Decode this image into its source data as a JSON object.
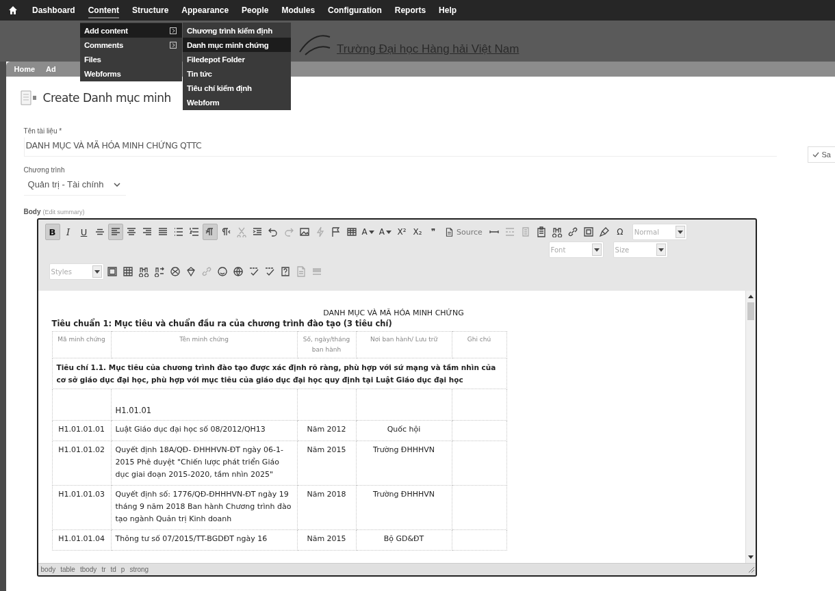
{
  "admin_menu": [
    {
      "label": "Dashboard",
      "selected": false
    },
    {
      "label": "Content",
      "selected": true
    },
    {
      "label": "Structure",
      "selected": false
    },
    {
      "label": "Appearance",
      "selected": false
    },
    {
      "label": "People",
      "selected": false
    },
    {
      "label": "Modules",
      "selected": false
    },
    {
      "label": "Configuration",
      "selected": false
    },
    {
      "label": "Reports",
      "selected": false
    },
    {
      "label": "Help",
      "selected": false
    }
  ],
  "content_menu": [
    {
      "label": "Add content",
      "selected": true,
      "has_submenu": true
    },
    {
      "label": "Comments",
      "selected": false,
      "has_submenu": true
    },
    {
      "label": "Files",
      "selected": false,
      "has_submenu": false
    },
    {
      "label": "Webforms",
      "selected": false,
      "has_submenu": false
    }
  ],
  "add_content_menu": [
    {
      "label": "Chương trình kiểm định",
      "selected": false
    },
    {
      "label": "Danh mục minh chứng",
      "selected": true
    },
    {
      "label": "Filedepot Folder",
      "selected": false
    },
    {
      "label": "Tin tức",
      "selected": false
    },
    {
      "label": "Tiêu chí kiểm định",
      "selected": false
    },
    {
      "label": "Webform",
      "selected": false
    }
  ],
  "header": {
    "site_name": "Trường Đại học Hàng hải Việt Nam"
  },
  "breadcrumb": [
    "Home",
    "Ad"
  ],
  "page_title": "Create Danh mục minh",
  "save_button": "Sa",
  "title_field": {
    "label": "Tên tài liệu *",
    "value": "DANH MỤC VÀ MÃ HÓA MINH CHỨNG QTTC"
  },
  "program_field": {
    "label": "Chương trình",
    "value": "Quản trị - Tài chính"
  },
  "body_field": {
    "label": "Body",
    "link": "(Edit summary)"
  },
  "editor": {
    "toolbar_row_1": [
      {
        "kind": "glyph",
        "label": "B",
        "active": true,
        "disabled": false
      },
      {
        "kind": "glyph",
        "label": "I",
        "active": false,
        "disabled": false
      },
      {
        "kind": "glyph",
        "label": "U",
        "active": false,
        "disabled": false
      },
      {
        "kind": "strikethrough",
        "active": false,
        "disabled": false
      },
      {
        "kind": "align-left",
        "active": true,
        "disabled": false
      },
      {
        "kind": "align-center",
        "active": false,
        "disabled": false
      },
      {
        "kind": "align-right",
        "active": false,
        "disabled": false
      },
      {
        "kind": "align-justify",
        "active": false,
        "disabled": false
      },
      {
        "kind": "bullet-list",
        "active": false,
        "disabled": false
      },
      {
        "kind": "numbered-list",
        "active": false,
        "disabled": false
      },
      {
        "kind": "paragraph-ltr",
        "active": true,
        "disabled": false
      },
      {
        "kind": "paragraph-rtl",
        "active": false,
        "disabled": false
      },
      {
        "kind": "scissors",
        "active": false,
        "disabled": true
      },
      {
        "kind": "indent",
        "active": false,
        "disabled": false
      },
      {
        "kind": "undo",
        "active": false,
        "disabled": false
      },
      {
        "kind": "redo",
        "active": false,
        "disabled": true
      },
      {
        "kind": "image",
        "active": false,
        "disabled": false
      },
      {
        "kind": "lightning",
        "active": false,
        "disabled": true
      },
      {
        "kind": "flag",
        "active": false,
        "disabled": false
      },
      {
        "kind": "table",
        "active": false,
        "disabled": false
      },
      {
        "kind": "color-glyph",
        "label": "A",
        "active": false,
        "disabled": false
      },
      {
        "kind": "color-glyph",
        "label": "A",
        "active": false,
        "disabled": false
      },
      {
        "kind": "glyph",
        "label": "X²",
        "active": false,
        "disabled": false
      },
      {
        "kind": "glyph",
        "label": "X₂",
        "active": false,
        "disabled": false
      },
      {
        "kind": "glyph",
        "label": "❞",
        "active": false,
        "disabled": false
      },
      {
        "kind": "source",
        "label": "Source",
        "active": false,
        "disabled": false
      },
      {
        "kind": "horizontal-rule",
        "active": false,
        "disabled": false
      },
      {
        "kind": "page-break",
        "active": false,
        "disabled": true
      },
      {
        "kind": "paste-text",
        "active": false,
        "disabled": true
      },
      {
        "kind": "clipboard",
        "active": false,
        "disabled": false
      },
      {
        "kind": "binoculars",
        "active": false,
        "disabled": false
      },
      {
        "kind": "link",
        "active": false,
        "disabled": false
      },
      {
        "kind": "select-all",
        "active": false,
        "disabled": false
      },
      {
        "kind": "brush",
        "active": false,
        "disabled": false
      },
      {
        "kind": "glyph",
        "label": "Ω",
        "active": false,
        "disabled": false
      },
      {
        "kind": "combo",
        "label": "Normal",
        "active": false,
        "disabled": false
      }
    ],
    "font_combos": [
      {
        "label": "Font"
      },
      {
        "label": "Size"
      }
    ],
    "toolbar_row_2": [
      {
        "kind": "combo",
        "label": "Styles",
        "active": false,
        "disabled": false
      },
      {
        "kind": "frame",
        "active": false,
        "disabled": false
      },
      {
        "kind": "grid",
        "active": false,
        "disabled": false
      },
      {
        "kind": "binoculars",
        "active": false,
        "disabled": false
      },
      {
        "kind": "replace",
        "active": false,
        "disabled": false
      },
      {
        "kind": "ball",
        "active": false,
        "disabled": false
      },
      {
        "kind": "gem",
        "active": false,
        "disabled": false
      },
      {
        "kind": "link",
        "active": false,
        "disabled": true
      },
      {
        "kind": "smiley",
        "active": false,
        "disabled": false
      },
      {
        "kind": "globe",
        "active": false,
        "disabled": false
      },
      {
        "kind": "spellcheck",
        "active": false,
        "disabled": false
      },
      {
        "kind": "spellcheck",
        "active": false,
        "disabled": false
      },
      {
        "kind": "help",
        "active": false,
        "disabled": false
      },
      {
        "kind": "document",
        "active": false,
        "disabled": true
      },
      {
        "kind": "lines",
        "active": false,
        "disabled": true
      }
    ],
    "document": {
      "heading": "DANH MỤC VÀ MÃ HÓA MINH CHỨNG",
      "standard": "Tiêu chuẩn 1: Mục tiêu và chuẩn đầu ra của chương trình đào tạo (3 tiêu chí)",
      "columns": [
        "Mã minh chứng",
        "Tên minh chứng",
        "Số, ngày/tháng ban hành",
        "Nơi ban hành/ Lưu trữ",
        "Ghi chú"
      ],
      "rows": [
        {
          "kind": "criterion",
          "text": "Tiêu chí 1.1. Mục tiêu của chương trình đào tạo được xác định rõ ràng, phù hợp với sứ mạng và tầm nhìn của cơ sở giáo dục đại học, phù hợp với mục tiêu của giáo dục đại học quy định tại Luật Giáo dục đại học"
        },
        {
          "kind": "group",
          "code": "H1.01.01"
        },
        {
          "kind": "item",
          "cells": [
            "H1.01.01.01",
            "Luật Giáo dục đại học số 08/2012/QH13",
            "Năm 2012",
            "Quốc hội"
          ]
        },
        {
          "kind": "item",
          "cells": [
            "H1.01.01.02",
            "Quyết định 18A/QĐ- ĐHHHVN-ĐT ngày 06-1-2015 Phê duyệt \"Chiến lược phát triển Giáo dục giai đoạn 2015-2020, tầm nhìn 2025\"",
            "Năm 2015",
            "Trường ĐHHHVN"
          ]
        },
        {
          "kind": "item",
          "cells": [
            "H1.01.01.03",
            "Quyết định số: 1776/QĐ-ĐHHHVN-ĐT ngày 19 tháng 9 năm 2018 Ban hành Chương trình đào tạo ngành Quản trị Kinh doanh",
            "Năm 2018",
            "Trường ĐHHHVN"
          ]
        },
        {
          "kind": "item",
          "cells": [
            "H1.01.01.04",
            "Thông tư số 07/2015/TT-BGDĐT ngày 16",
            "Năm 2015",
            "Bộ GD&ĐT"
          ]
        }
      ]
    },
    "element_path": [
      "body",
      "table",
      "tbody",
      "tr",
      "td",
      "p",
      "strong"
    ]
  }
}
